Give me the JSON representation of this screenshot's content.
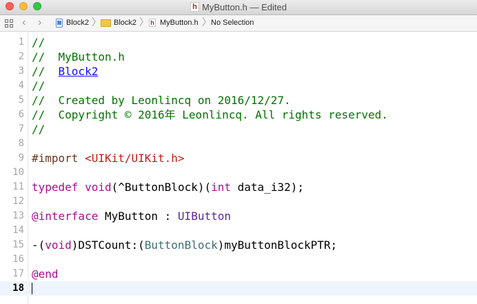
{
  "window": {
    "file_name": "MyButton.h",
    "title_separator": "—",
    "status": "Edited",
    "file_icon_letter": "h"
  },
  "jumpbar": {
    "back_glyph": "‹",
    "forward_glyph": "›",
    "separator_glyph": "〉",
    "crumbs": [
      "Block2",
      "Block2",
      "MyButton.h",
      "No Selection"
    ]
  },
  "editor": {
    "current_line": 18,
    "lines": [
      {
        "n": "1",
        "parts": [
          {
            "t": "//",
            "k": "comment"
          }
        ]
      },
      {
        "n": "2",
        "parts": [
          {
            "t": "//  MyButton.h",
            "k": "comment"
          }
        ]
      },
      {
        "n": "3",
        "parts": [
          {
            "t": "//  ",
            "k": "comment"
          },
          {
            "t": "Block2",
            "k": "link"
          }
        ]
      },
      {
        "n": "4",
        "parts": [
          {
            "t": "//",
            "k": "comment"
          }
        ]
      },
      {
        "n": "5",
        "parts": [
          {
            "t": "//  Created by Leonlincq on 2016/12/27.",
            "k": "comment"
          }
        ]
      },
      {
        "n": "6",
        "parts": [
          {
            "t": "//  Copyright © 2016年 Leonlincq. All rights reserved.",
            "k": "comment"
          }
        ]
      },
      {
        "n": "7",
        "parts": [
          {
            "t": "//",
            "k": "comment"
          }
        ]
      },
      {
        "n": "8",
        "parts": []
      },
      {
        "n": "9",
        "parts": [
          {
            "t": "#import ",
            "k": "pre"
          },
          {
            "t": "<UIKit/UIKit.h>",
            "k": "str"
          }
        ]
      },
      {
        "n": "10",
        "parts": []
      },
      {
        "n": "11",
        "parts": [
          {
            "t": "typedef",
            "k": "kw"
          },
          {
            "t": " ",
            "k": "plain"
          },
          {
            "t": "void",
            "k": "kw"
          },
          {
            "t": "(^ButtonBlock)(",
            "k": "plain"
          },
          {
            "t": "int",
            "k": "kw"
          },
          {
            "t": " data_i32);",
            "k": "plain"
          }
        ]
      },
      {
        "n": "12",
        "parts": []
      },
      {
        "n": "13",
        "parts": [
          {
            "t": "@interface",
            "k": "kw"
          },
          {
            "t": " MyButton : ",
            "k": "plain"
          },
          {
            "t": "UIButton",
            "k": "cls"
          }
        ]
      },
      {
        "n": "14",
        "parts": []
      },
      {
        "n": "15",
        "parts": [
          {
            "t": "-(",
            "k": "plain"
          },
          {
            "t": "void",
            "k": "kw"
          },
          {
            "t": ")DSTCount:(",
            "k": "plain"
          },
          {
            "t": "ButtonBlock",
            "k": "type"
          },
          {
            "t": ")myButtonBlockPTR;",
            "k": "plain"
          }
        ]
      },
      {
        "n": "16",
        "parts": []
      },
      {
        "n": "17",
        "parts": [
          {
            "t": "@end",
            "k": "kw"
          }
        ]
      },
      {
        "n": "18",
        "parts": []
      }
    ]
  }
}
